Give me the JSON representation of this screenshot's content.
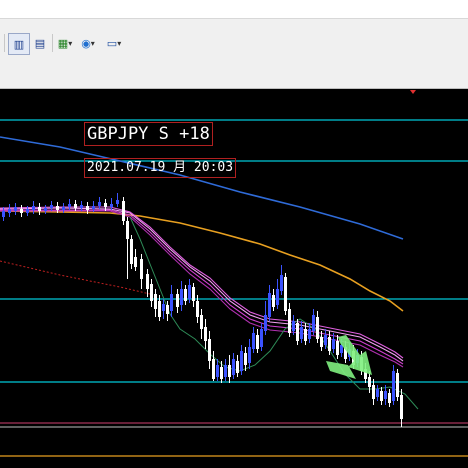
{
  "toolbar": {
    "buttons": [
      {
        "name": "period-separator-button",
        "icon": "bar-chart-icon",
        "glyph": "▥",
        "dropdown": false
      },
      {
        "name": "chart-shift-button",
        "icon": "chart-shift-icon",
        "glyph": "▤",
        "dropdown": false
      },
      {
        "name": "indicators-button",
        "icon": "indicator-add-icon",
        "glyph": "▦",
        "dropdown": true
      },
      {
        "name": "periodicity-button",
        "icon": "clock-icon",
        "glyph": "◉",
        "dropdown": true
      },
      {
        "name": "templates-button",
        "icon": "template-icon",
        "glyph": "▭",
        "dropdown": true
      }
    ],
    "dropdown_glyph": "▾"
  },
  "chart": {
    "symbol_label": "GBPJPY S +18",
    "datetime_label": "2021.07.19 月 20:03",
    "colors": {
      "background": "#000000",
      "bull_candle": "#3b52ff",
      "bear_candle": "#ffffff",
      "horizontal_lines": "#00c8d8",
      "ma_long": "#2f6bd8",
      "ma_mid": "#e8a020",
      "ma_ribbon": "#d040d0",
      "ma_ribbon_light": "#f0a0f0",
      "envelope": "#2e8b57",
      "signal_arrow": "#80f080",
      "label_border": "#b02020"
    }
  }
}
